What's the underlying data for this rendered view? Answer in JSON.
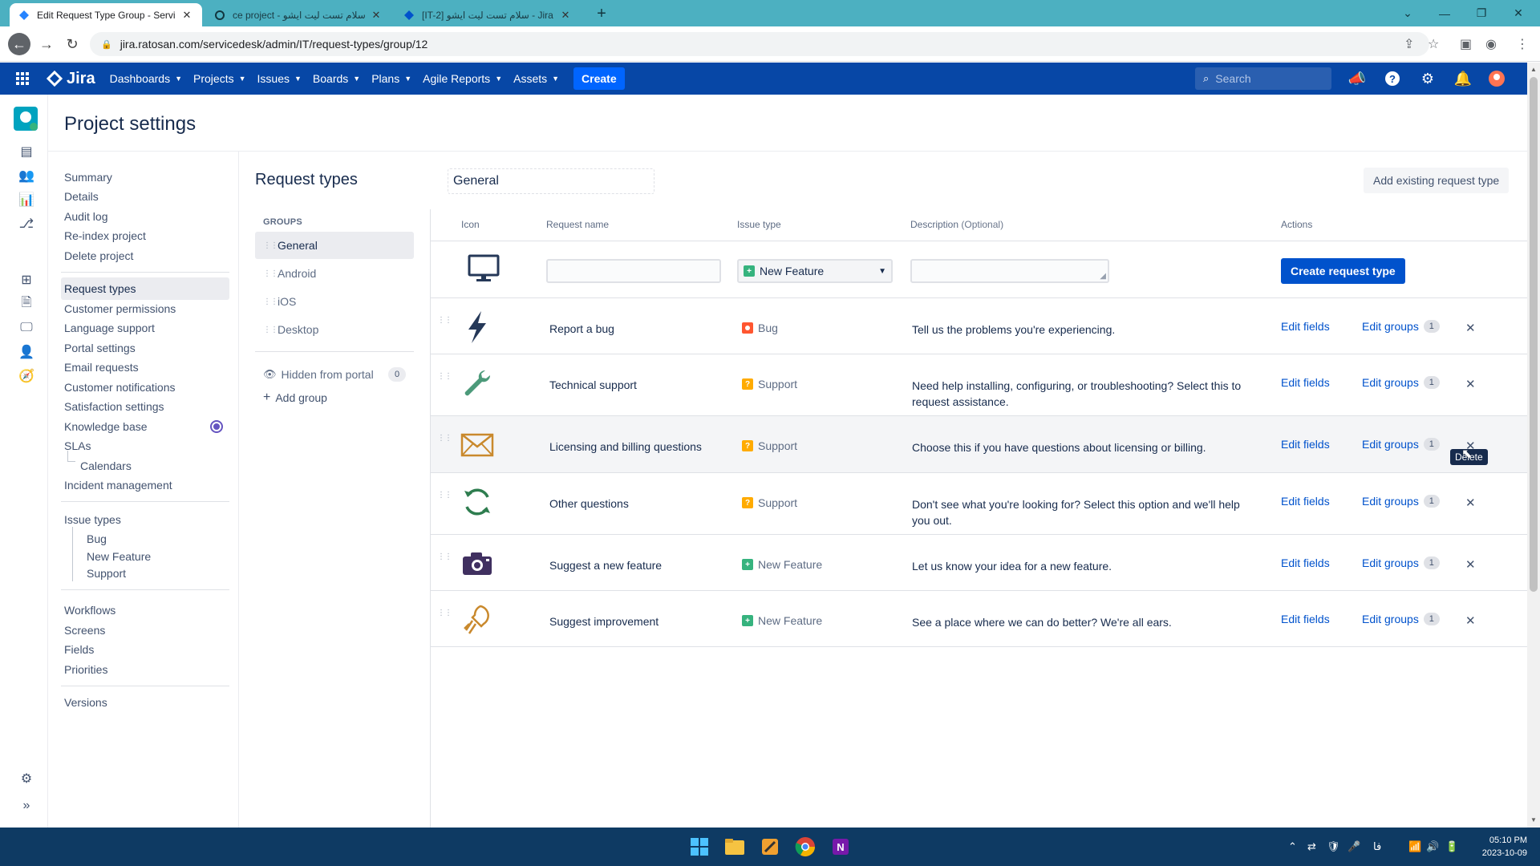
{
  "browser": {
    "tabs": [
      {
        "label": "Edit Request Type Group - Servi",
        "active": true
      },
      {
        "label": "ce project - سلام تست لیت ایشو",
        "active": false
      },
      {
        "label": "[IT-2] سلام تست لیت ایشو - Jira",
        "active": false
      }
    ],
    "url": "jira.ratosan.com/servicedesk/admin/IT/request-types/group/12"
  },
  "jira_nav": {
    "logo": "Jira",
    "menus": [
      "Dashboards",
      "Projects",
      "Issues",
      "Boards",
      "Plans",
      "Agile Reports",
      "Assets"
    ],
    "create_label": "Create",
    "search_placeholder": "Search"
  },
  "page": {
    "title": "Project settings"
  },
  "settings_nav": {
    "group1": [
      "Summary",
      "Details",
      "Audit log",
      "Re-index project",
      "Delete project"
    ],
    "group2": [
      "Request types",
      "Customer permissions",
      "Language support",
      "Portal settings",
      "Email requests",
      "Customer notifications",
      "Satisfaction settings",
      "Knowledge base",
      "SLAs",
      "Calendars",
      "Incident management"
    ],
    "issue_types_label": "Issue types",
    "issue_types": [
      "Bug",
      "New Feature",
      "Support"
    ],
    "group4": [
      "Workflows",
      "Screens",
      "Fields",
      "Priorities"
    ],
    "group5": [
      "Versions"
    ]
  },
  "groups_panel": {
    "title": "Request types",
    "heading": "GROUPS",
    "groups": [
      "General",
      "Android",
      "iOS",
      "Desktop"
    ],
    "hidden_label": "Hidden from portal",
    "hidden_count": "0",
    "add_group": "Add group"
  },
  "main": {
    "group_name": "General",
    "add_existing": "Add existing request type",
    "columns": {
      "icon": "Icon",
      "name": "Request name",
      "issue_type": "Issue type",
      "description": "Description",
      "description_opt": "(Optional)",
      "actions": "Actions"
    },
    "new_row": {
      "issue_type_value": "New Feature",
      "create_button": "Create request type"
    },
    "rows": [
      {
        "icon": "lightning-bolt-icon",
        "name": "Report a bug",
        "type": "Bug",
        "type_icon": "bug",
        "description": "Tell us the problems you're experiencing.",
        "edit_fields": "Edit fields",
        "edit_groups": "Edit groups",
        "groups_count": "1"
      },
      {
        "icon": "wrench-icon",
        "name": "Technical support",
        "type": "Support",
        "type_icon": "support",
        "description": "Need help installing, configuring, or troubleshooting? Select this to request assistance.",
        "edit_fields": "Edit fields",
        "edit_groups": "Edit groups",
        "groups_count": "1"
      },
      {
        "icon": "envelope-icon",
        "name": "Licensing and billing questions",
        "type": "Support",
        "type_icon": "support",
        "description": "Choose this if you have questions about licensing or billing.",
        "edit_fields": "Edit fields",
        "edit_groups": "Edit groups",
        "groups_count": "1"
      },
      {
        "icon": "refresh-cycle-icon",
        "name": "Other questions",
        "type": "Support",
        "type_icon": "support",
        "description": "Don't see what you're looking for? Select this option and we'll help you out.",
        "edit_fields": "Edit fields",
        "edit_groups": "Edit groups",
        "groups_count": "1"
      },
      {
        "icon": "camera-icon",
        "name": "Suggest a new feature",
        "type": "New Feature",
        "type_icon": "feature",
        "description": "Let us know your idea for a new feature.",
        "edit_fields": "Edit fields",
        "edit_groups": "Edit groups",
        "groups_count": "1"
      },
      {
        "icon": "lightbulb-icon",
        "name": "Suggest improvement",
        "type": "New Feature",
        "type_icon": "feature",
        "description": "See a place where we can do better? We're all ears.",
        "edit_fields": "Edit fields",
        "edit_groups": "Edit groups",
        "groups_count": "1"
      }
    ],
    "tooltip": "Delete"
  },
  "taskbar": {
    "time": "05:10 PM",
    "date": "2023-10-09",
    "lang": "فا"
  },
  "colors": {
    "jira_blue": "#0747a6",
    "create_blue": "#0052cc",
    "tab_bar": "#4cb0c1",
    "taskbar": "#0e3a63"
  }
}
